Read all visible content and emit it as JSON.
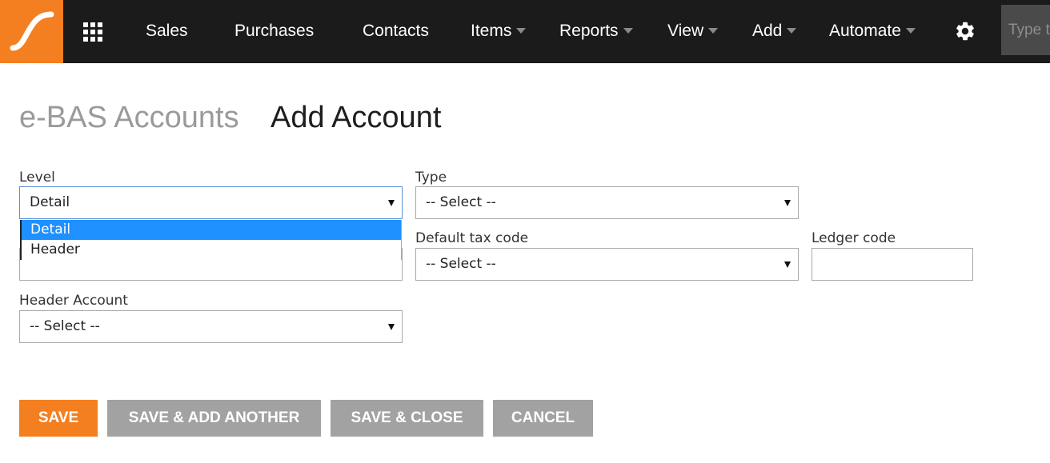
{
  "nav": {
    "items": [
      {
        "label": "Sales",
        "dropdown": false
      },
      {
        "label": "Purchases",
        "dropdown": false
      },
      {
        "label": "Contacts",
        "dropdown": false
      },
      {
        "label": "Items",
        "dropdown": true
      },
      {
        "label": "Reports",
        "dropdown": true
      },
      {
        "label": "View",
        "dropdown": true
      },
      {
        "label": "Add",
        "dropdown": true
      },
      {
        "label": "Automate",
        "dropdown": true
      }
    ],
    "search_placeholder": "Type t",
    "icons": {
      "logo": "swoosh-logo-icon",
      "apps": "app-grid-icon",
      "settings": "gear-icon"
    },
    "colors": {
      "bar": "#1b1b1b",
      "logo": "#f47f20",
      "search": "#4a4a4a"
    }
  },
  "header": {
    "breadcrumb": "e-BAS Accounts",
    "title": "Add Account"
  },
  "form": {
    "level": {
      "label": "Level",
      "value": "Detail",
      "options": [
        "Detail",
        "Header"
      ],
      "highlighted": "Detail"
    },
    "type": {
      "label": "Type",
      "value": "-- Select --"
    },
    "default_tax_code": {
      "label": "Default tax code",
      "value": "-- Select --"
    },
    "ledger_code": {
      "label": "Ledger code",
      "value": ""
    },
    "header_account": {
      "label": "Header Account",
      "value": "-- Select --"
    }
  },
  "actions": {
    "save": "SAVE",
    "save_add_another": "SAVE & ADD ANOTHER",
    "save_close": "SAVE & CLOSE",
    "cancel": "CANCEL",
    "colors": {
      "primary": "#f47f20",
      "secondary": "#a2a2a2",
      "highlight": "#1e90ff"
    }
  }
}
